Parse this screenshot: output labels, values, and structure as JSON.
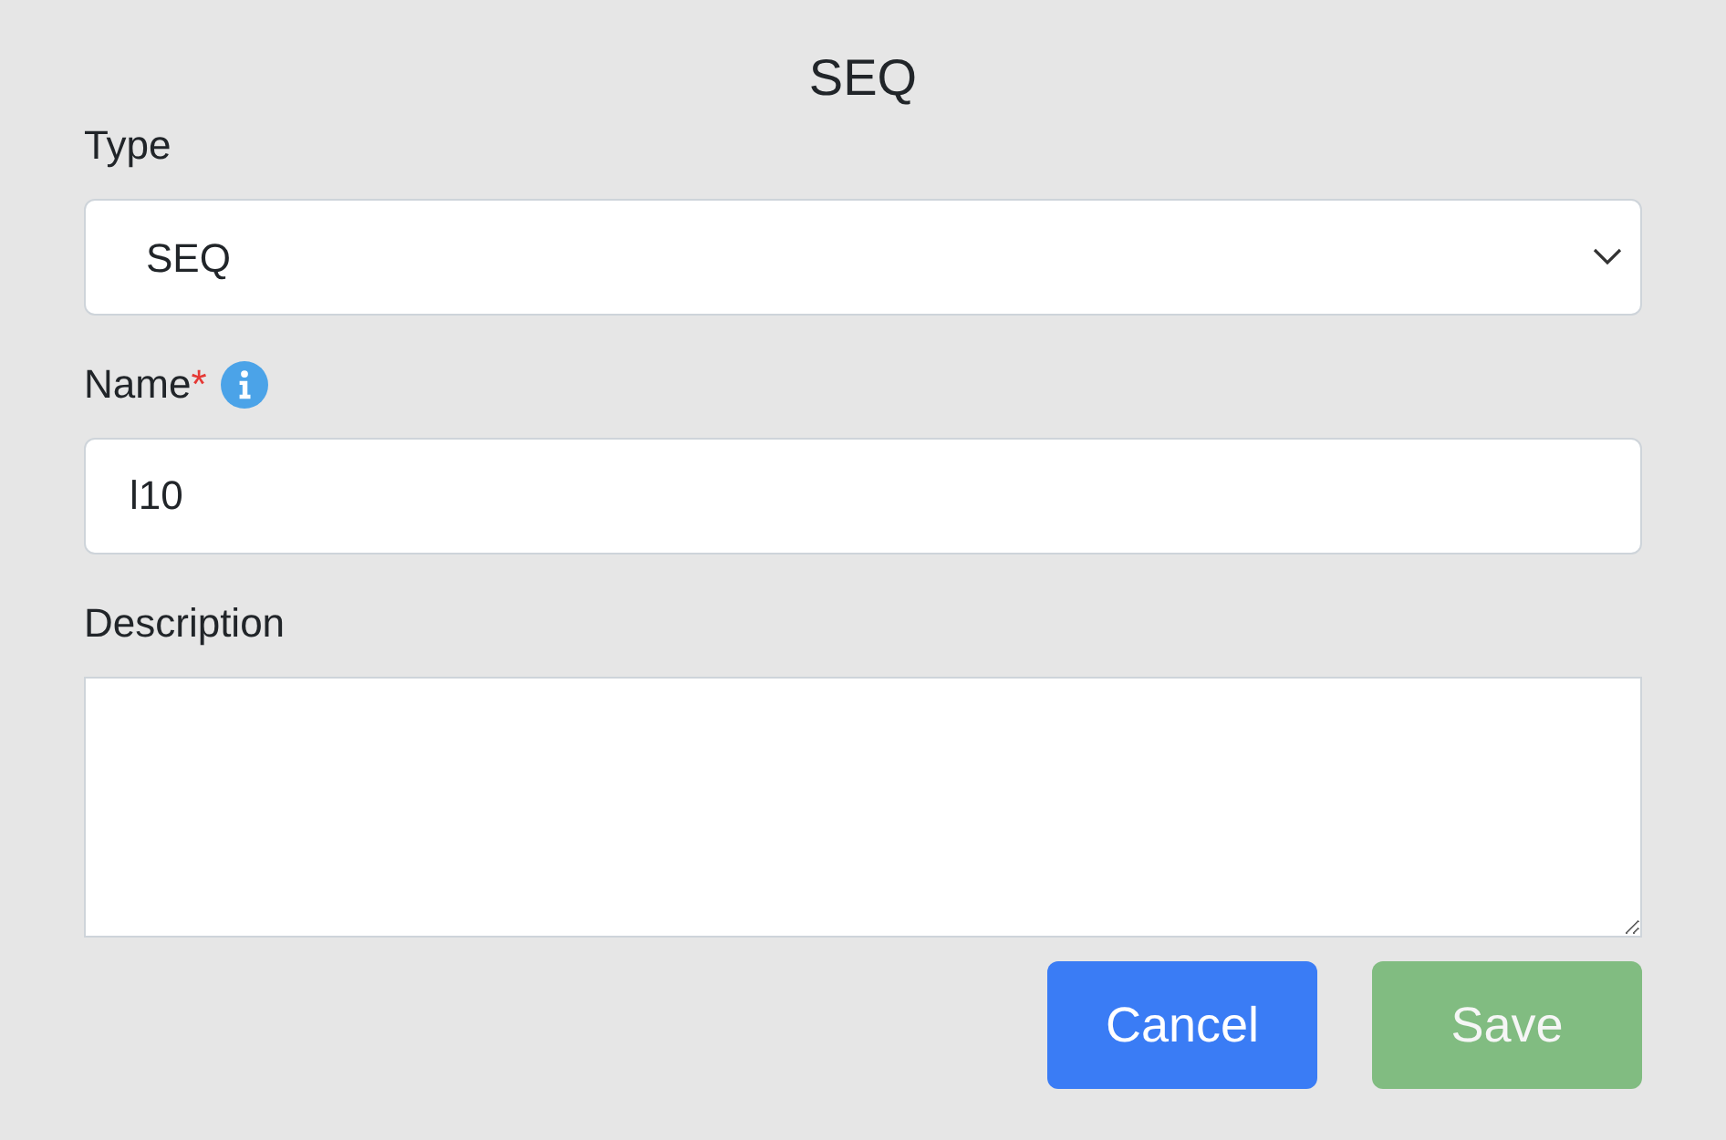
{
  "title": "SEQ",
  "fields": [
    {
      "kind": "select",
      "label": "Type",
      "value": "SEQ"
    },
    {
      "kind": "input",
      "label": "Name",
      "required_mark": "*",
      "info": true,
      "value": "l10"
    },
    {
      "kind": "textarea",
      "label": "Description"
    }
  ],
  "buttons": [
    {
      "kind": "cancel",
      "label": "Cancel",
      "disabled": false
    },
    {
      "kind": "save",
      "label": "Save",
      "disabled": true
    }
  ]
}
